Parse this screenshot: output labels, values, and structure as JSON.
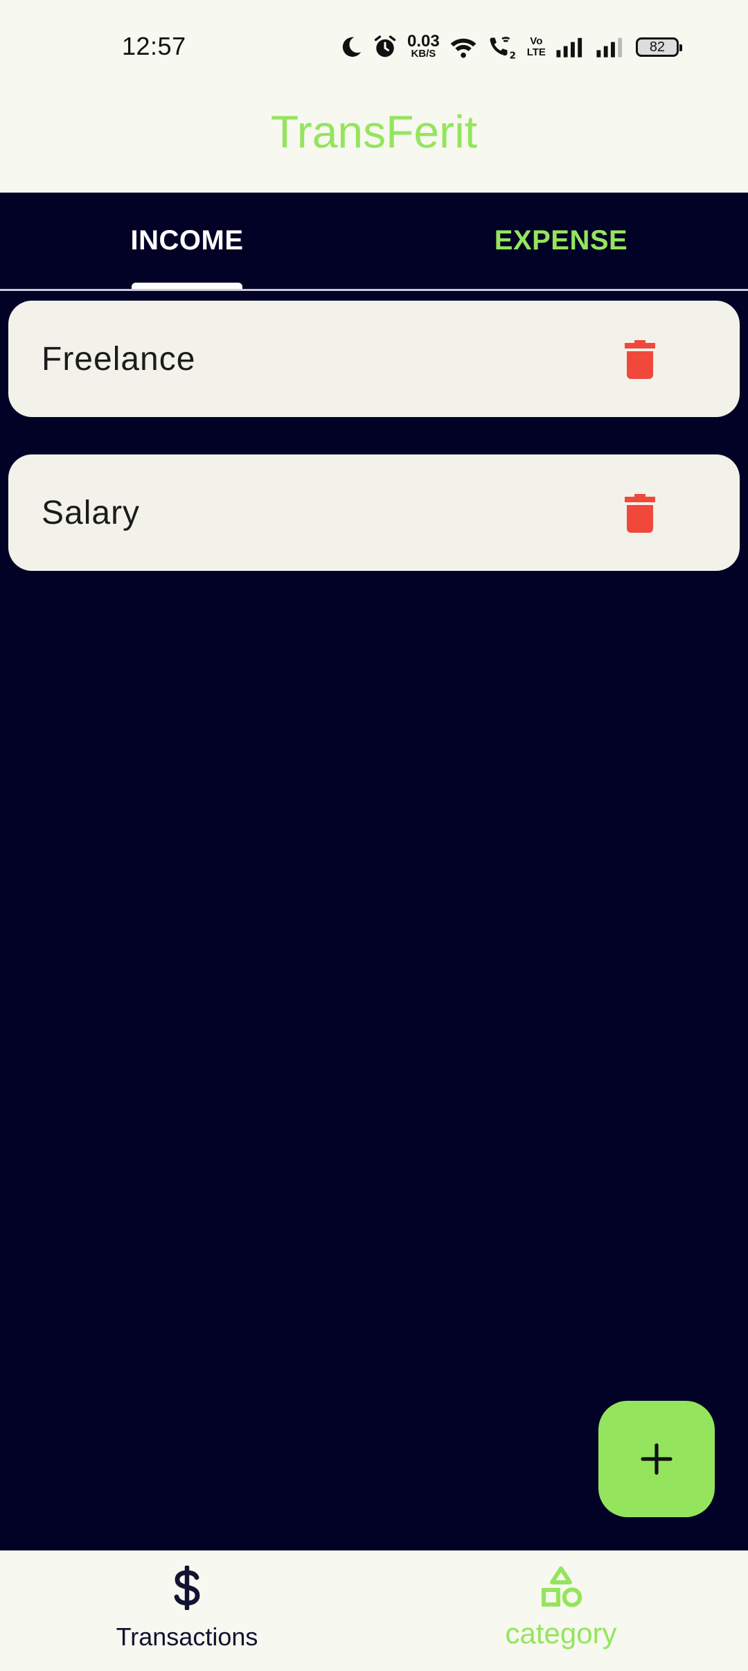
{
  "status_bar": {
    "time": "12:57",
    "net_speed": "0.03",
    "net_speed_unit": "KB/S",
    "volte_top": "Vo",
    "volte_bottom": "LTE",
    "sim_indicator": "2",
    "battery": "82",
    "icons": [
      "moon-icon",
      "alarm-icon",
      "wifi-icon",
      "wifi-calling-icon",
      "signal-icon",
      "battery-icon"
    ]
  },
  "app_bar": {
    "title": "TransFerit",
    "title_color": "#94e55d"
  },
  "tabs": [
    {
      "label": "INCOME",
      "selected": true
    },
    {
      "label": "EXPENSE",
      "selected": false
    }
  ],
  "categories": [
    {
      "name": "Freelance",
      "action_icon": "trash-icon"
    },
    {
      "name": "Salary",
      "action_icon": "trash-icon"
    }
  ],
  "fab": {
    "icon": "plus-icon"
  },
  "bottom_nav": [
    {
      "label": "Transactions",
      "icon": "dollar-icon"
    },
    {
      "label": "category",
      "icon": "shapes-icon",
      "selected": true
    }
  ],
  "colors": {
    "background": "#020226",
    "accent": "#94e55d",
    "surface": "#f2f2ea",
    "delete": "#f0483b"
  }
}
